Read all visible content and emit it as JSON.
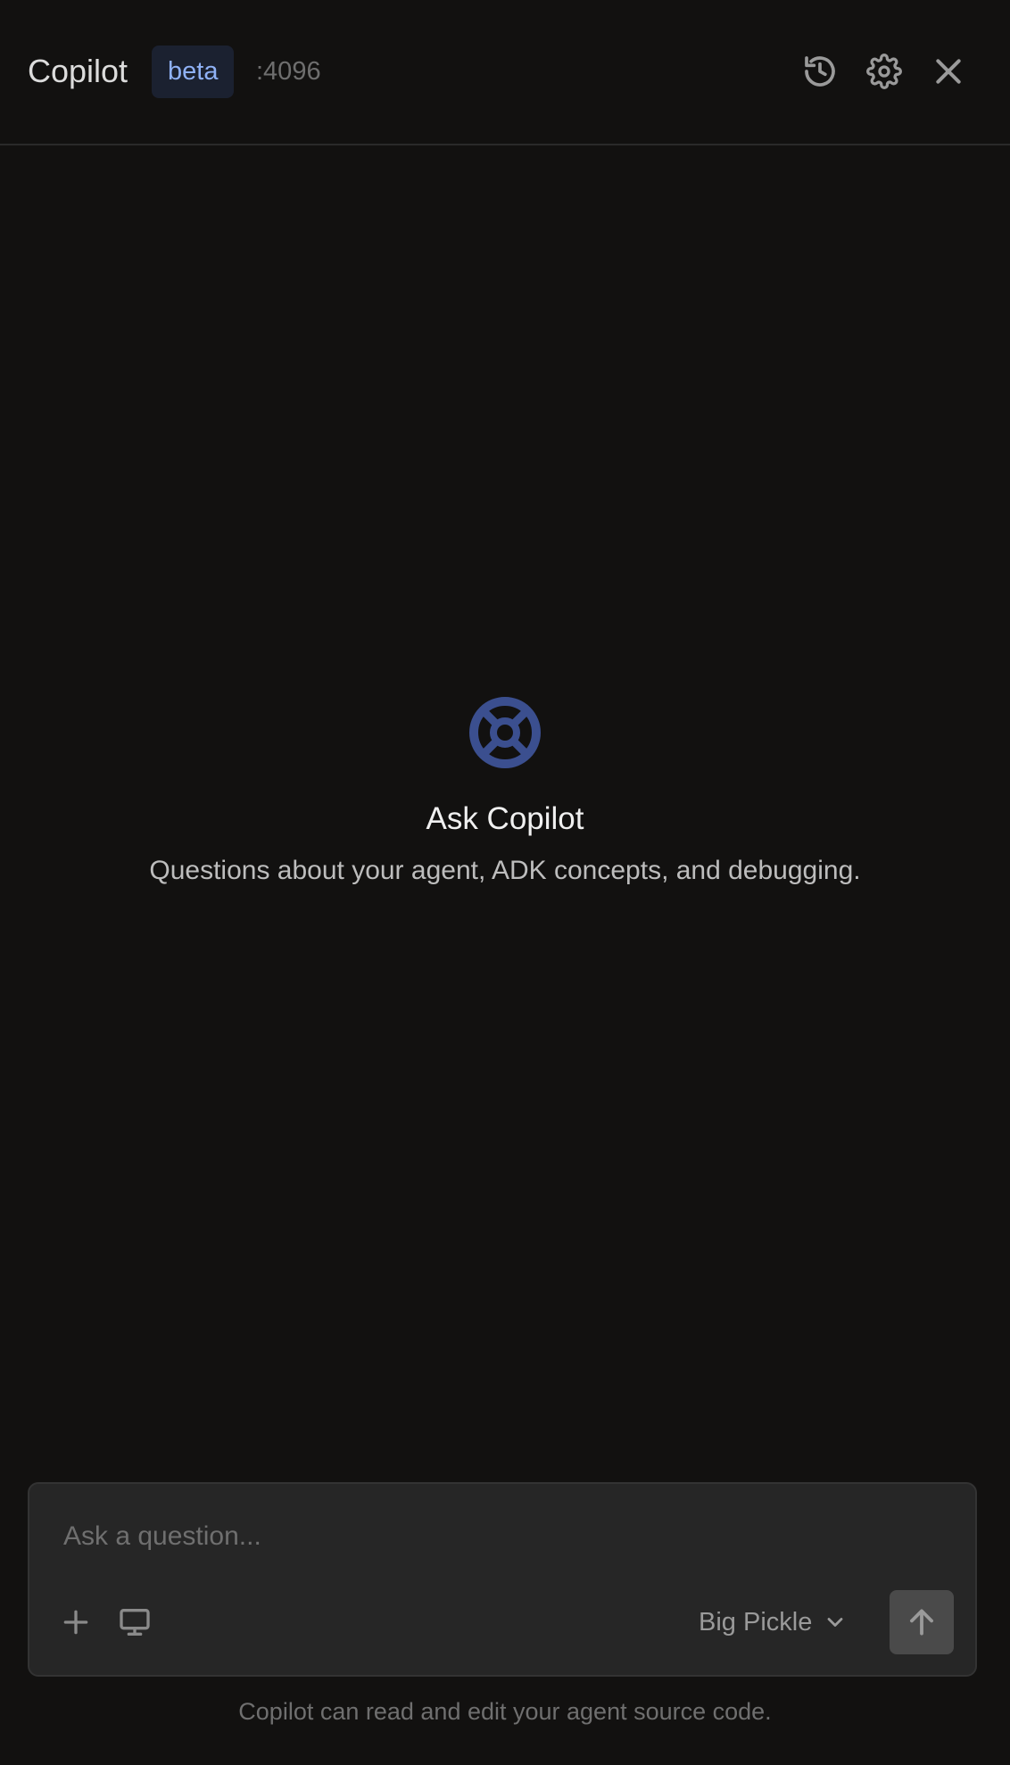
{
  "header": {
    "title": "Copilot",
    "badge": "beta",
    "port": ":4096",
    "icons": [
      "history-icon",
      "gear-icon",
      "close-icon"
    ]
  },
  "empty_state": {
    "icon": "lifebuoy-icon",
    "title": "Ask Copilot",
    "subtitle": "Questions about your agent, ADK concepts, and debugging."
  },
  "composer": {
    "placeholder": "Ask a question...",
    "value": "",
    "tools": [
      "plus-icon",
      "monitor-icon"
    ],
    "model": "Big Pickle",
    "send_icon": "arrow-up-icon"
  },
  "footer": {
    "note": "Copilot can read and edit your agent source code."
  },
  "colors": {
    "background": "#121110",
    "badge_bg": "#1b2130",
    "badge_text": "#8fb1f5",
    "icon_accent": "#3b4f8f",
    "composer_bg": "#262626",
    "send_bg": "#4a4a4a"
  }
}
